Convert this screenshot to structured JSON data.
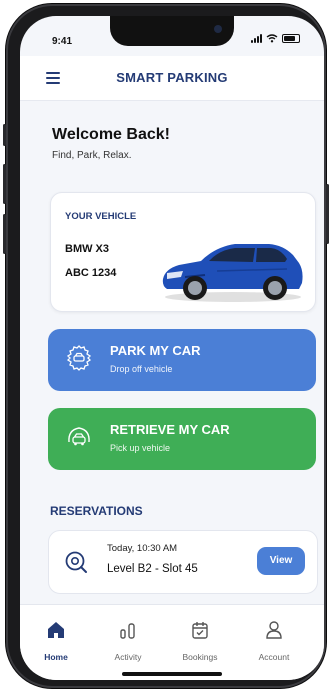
{
  "status_bar": {
    "time": "9:41"
  },
  "header": {
    "title": "SMART PARKING"
  },
  "welcome": {
    "title": "Welcome Back!",
    "tagline": "Find, Park, Relax."
  },
  "vehicle": {
    "label": "YOUR VEHICLE",
    "model": "BMW X3",
    "plate": "ABC 1234"
  },
  "actions": [
    {
      "title": "PARK MY CAR",
      "subtitle": "Drop off vehicle"
    },
    {
      "title": "RETRIEVE MY CAR",
      "subtitle": "Pick up vehicle"
    }
  ],
  "reservations": {
    "title": "RESERVATIONS",
    "items": [
      {
        "time": "Today, 10:30 AM",
        "slot": "Level B2 - Slot 45",
        "action_label": "View"
      }
    ]
  },
  "tabs": [
    {
      "label": "Home",
      "icon": "home-icon",
      "active": true
    },
    {
      "label": "Activity",
      "icon": "activity-icon",
      "active": false
    },
    {
      "label": "Bookings",
      "icon": "bookings-icon",
      "active": false
    },
    {
      "label": "Account",
      "icon": "account-icon",
      "active": false
    }
  ],
  "colors": {
    "brand": "#243b75",
    "park_button": "#4b7fd6",
    "retrieve_button": "#3fae56",
    "car_body": "#1f4fb8"
  }
}
